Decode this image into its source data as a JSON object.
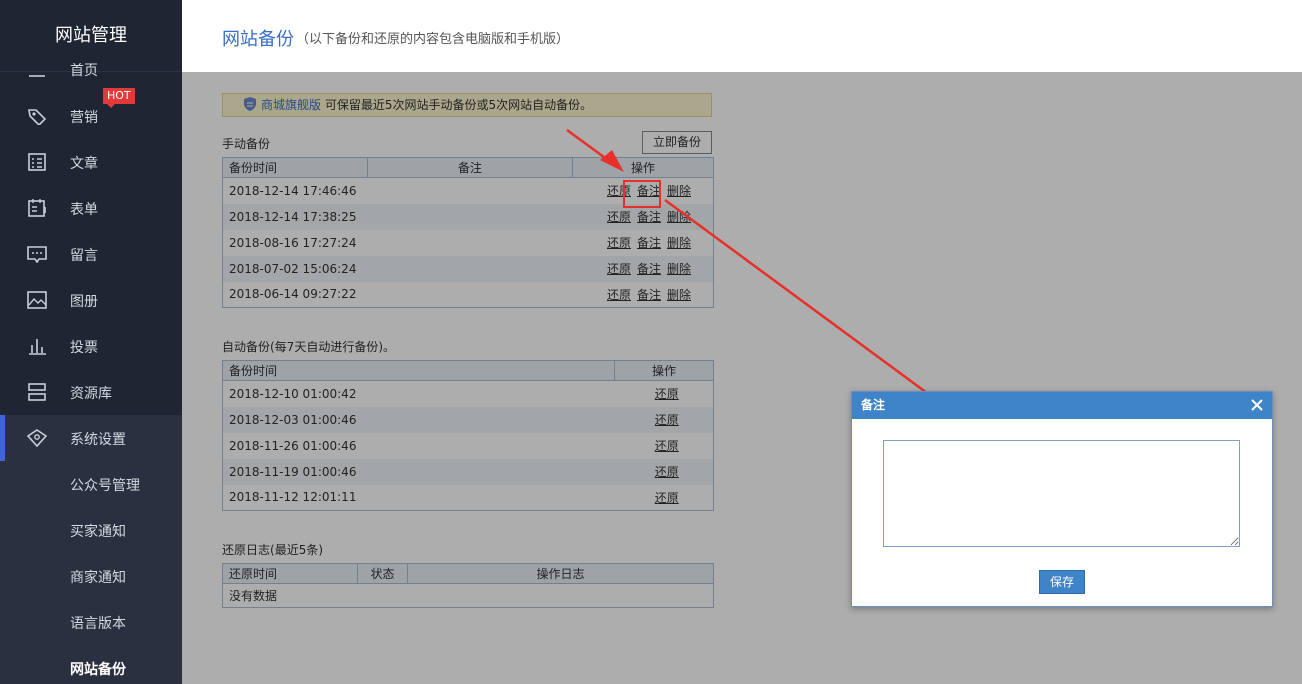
{
  "sidebar": {
    "brand": "网站管理",
    "partial_item": "首页",
    "hot_badge": "HOT",
    "items": [
      {
        "label": "营销",
        "icon": "tag-icon"
      },
      {
        "label": "文章",
        "icon": "article-icon"
      },
      {
        "label": "表单",
        "icon": "form-icon"
      },
      {
        "label": "留言",
        "icon": "message-icon"
      },
      {
        "label": "图册",
        "icon": "gallery-icon"
      },
      {
        "label": "投票",
        "icon": "vote-icon"
      },
      {
        "label": "资源库",
        "icon": "resource-icon"
      },
      {
        "label": "系统设置",
        "icon": "settings-icon"
      }
    ],
    "subitems": [
      "公众号管理",
      "买家通知",
      "商家通知",
      "语言版本",
      "网站备份"
    ]
  },
  "header": {
    "title": "网站备份",
    "subtitle": "（以下备份和还原的内容包含电脑版和手机版）"
  },
  "notice": {
    "brand": "商城旗舰版",
    "text": "可保留最近5次网站手动备份或5次网站自动备份。"
  },
  "manual": {
    "title": "手动备份",
    "button": "立即备份",
    "headers": [
      "备份时间",
      "备注",
      "操作"
    ],
    "actions": [
      "还原",
      "备注",
      "删除"
    ],
    "rows": [
      "2018-12-14 17:46:46",
      "2018-12-14 17:38:25",
      "2018-08-16 17:27:24",
      "2018-07-02 15:06:24",
      "2018-06-14 09:27:22"
    ]
  },
  "auto": {
    "title": "自动备份(每7天自动进行备份)。",
    "headers": [
      "备份时间",
      "操作"
    ],
    "action": "还原",
    "rows": [
      "2018-12-10 01:00:42",
      "2018-12-03 01:00:46",
      "2018-11-26 01:00:46",
      "2018-11-19 01:00:46",
      "2018-11-12 12:01:11"
    ]
  },
  "restore_log": {
    "title_main": "还原日志",
    "title_note": "(最近5条)",
    "headers": [
      "还原时间",
      "状态",
      "操作日志"
    ],
    "empty": "没有数据"
  },
  "dialog": {
    "title": "备注",
    "textarea_value": "",
    "save": "保存"
  },
  "colors": {
    "sidebar_bg": "#1f2532",
    "accent": "#3c66d8",
    "dialog_header": "#3f83c8",
    "annotation_red": "#e8302a"
  }
}
